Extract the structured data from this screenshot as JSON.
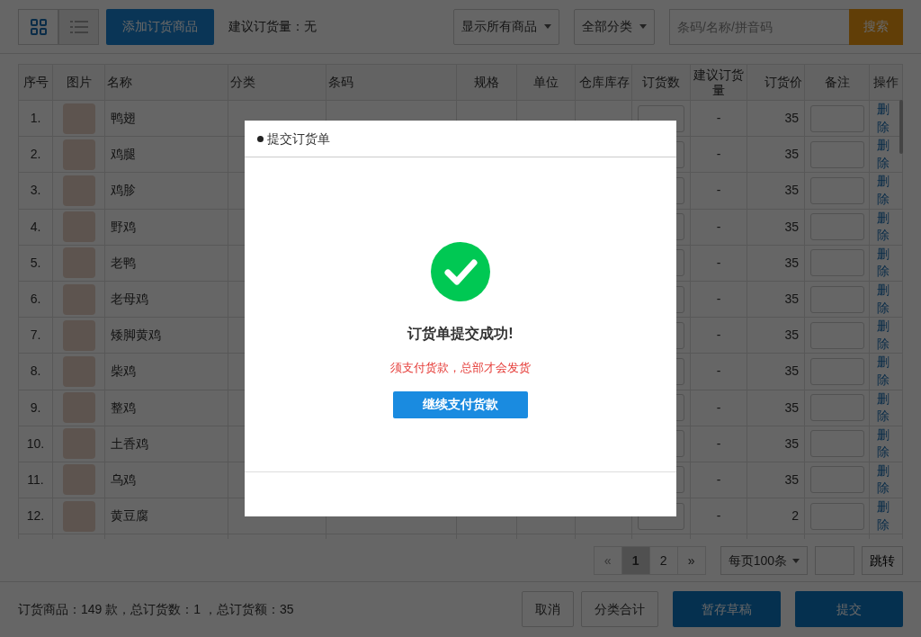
{
  "toolbar": {
    "view_toggles": [
      {
        "kind": "grid",
        "selected": true
      },
      {
        "kind": "list",
        "selected": false
      }
    ],
    "add_button": "添加订货商品",
    "suggestion": "建议订货量：无",
    "filters": [
      {
        "label": "显示所有商品"
      },
      {
        "label": "全部分类"
      }
    ],
    "search": {
      "placeholder": "条码/名称/拼音码",
      "button": "搜索"
    }
  },
  "table": {
    "columns": [
      "序号",
      "图片",
      "名称",
      "分类",
      "条码",
      "规格",
      "单位",
      "仓库库存",
      "订货数",
      "建议订货量",
      "订货价",
      "备注",
      "操作"
    ],
    "rows": [
      {
        "index": "1.",
        "name": "鸭翅",
        "suggested": "-",
        "price": "35",
        "action": "删除"
      },
      {
        "index": "2.",
        "name": "鸡腿",
        "suggested": "-",
        "price": "35",
        "action": "删除"
      },
      {
        "index": "3.",
        "name": "鸡胗",
        "suggested": "-",
        "price": "35",
        "action": "删除"
      },
      {
        "index": "4.",
        "name": "野鸡",
        "suggested": "-",
        "price": "35",
        "action": "删除"
      },
      {
        "index": "5.",
        "name": "老鸭",
        "suggested": "-",
        "price": "35",
        "action": "删除"
      },
      {
        "index": "6.",
        "name": "老母鸡",
        "suggested": "-",
        "price": "35",
        "action": "删除"
      },
      {
        "index": "7.",
        "name": "矮脚黄鸡",
        "suggested": "-",
        "price": "35",
        "action": "删除"
      },
      {
        "index": "8.",
        "name": "柴鸡",
        "suggested": "-",
        "price": "35",
        "action": "删除"
      },
      {
        "index": "9.",
        "name": "整鸡",
        "suggested": "-",
        "price": "35",
        "action": "删除"
      },
      {
        "index": "10.",
        "name": "土香鸡",
        "suggested": "-",
        "price": "35",
        "action": "删除"
      },
      {
        "index": "11.",
        "name": "乌鸡",
        "suggested": "-",
        "price": "35",
        "action": "删除"
      },
      {
        "index": "12.",
        "name": "黄豆腐",
        "suggested": "-",
        "price": "2",
        "action": "删除"
      }
    ]
  },
  "pagination": {
    "pages": [
      {
        "label": "«",
        "disabled": true,
        "selected": false
      },
      {
        "label": "1",
        "disabled": false,
        "selected": true
      },
      {
        "label": "2",
        "disabled": false,
        "selected": false
      },
      {
        "label": "»",
        "disabled": false,
        "selected": false
      }
    ],
    "page_size": "每页100条",
    "jump_button": "跳转"
  },
  "footer": {
    "summary": "订货商品：149 款，总订货数：1 ，总订货额：35",
    "buttons": [
      {
        "label": "取消",
        "kind": "outline"
      },
      {
        "label": "分类合计",
        "kind": "outline"
      },
      {
        "label": "暂存草稿",
        "kind": "primary"
      },
      {
        "label": "提交",
        "kind": "primary"
      }
    ]
  },
  "modal": {
    "title": "提交订货单",
    "heading": "订货单提交成功!",
    "message": "须支付货款，总部才会发货",
    "button": "继续支付货款"
  }
}
